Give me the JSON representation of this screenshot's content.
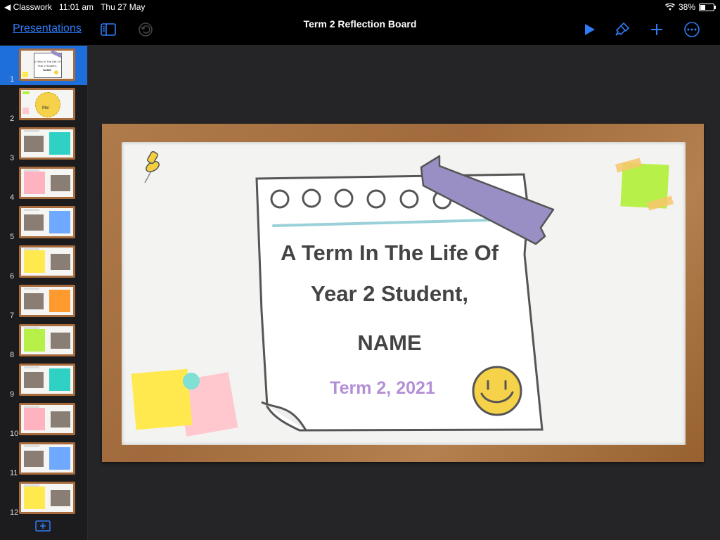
{
  "status_bar": {
    "back_app": "◀ Classwork",
    "time": "11:01 am",
    "date": "Thu 27 May",
    "battery": "38%",
    "battery_level": 0.38
  },
  "toolbar": {
    "back_label": "Presentations",
    "document_title": "Term 2 Reflection Board"
  },
  "slides": [
    {
      "number": "1",
      "selected": true
    },
    {
      "number": "2",
      "thumb_text": "Mei"
    },
    {
      "number": "3"
    },
    {
      "number": "4"
    },
    {
      "number": "5"
    },
    {
      "number": "6"
    },
    {
      "number": "7"
    },
    {
      "number": "8"
    },
    {
      "number": "9"
    },
    {
      "number": "10"
    },
    {
      "number": "11"
    },
    {
      "number": "12"
    }
  ],
  "slide1_thumb": {
    "line1": "A Term In The Life Of",
    "line2": "Year 2 Student,",
    "line3": "NAME"
  },
  "current_slide": {
    "title_line1": "A Term In The Life Of",
    "title_line2": "Year 2 Student,",
    "name": "NAME",
    "term": "Term 2, 2021",
    "term_color": "#b38fd6"
  },
  "colors": {
    "accent": "#2f7cf6",
    "selected_row": "#1e6fd9",
    "frame_wood": "#a86b3c",
    "tape_purple": "#9a8fc4",
    "note_yellow": "#ffe94f",
    "note_pink": "#ffc8cf",
    "note_green": "#b8f04a",
    "smiley_yellow": "#f6d24a"
  }
}
